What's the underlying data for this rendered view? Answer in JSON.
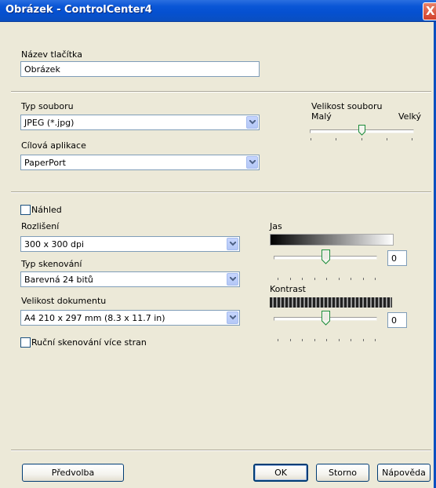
{
  "window": {
    "title": "Obrázek - ControlCenter4",
    "close_glyph": "X"
  },
  "button_name": {
    "label": "Název tlačítka",
    "value": "Obrázek"
  },
  "file_type": {
    "label": "Typ souboru",
    "value": "JPEG (*.jpg)"
  },
  "file_size": {
    "label": "Velikost souboru",
    "min_label": "Malý",
    "max_label": "Velký",
    "level": 0.5
  },
  "target_app": {
    "label": "Cílová aplikace",
    "value": "PaperPort"
  },
  "preview": {
    "label": "Náhled",
    "checked": false
  },
  "resolution": {
    "label": "Rozlišení",
    "value": "300 x 300 dpi"
  },
  "scan_type": {
    "label": "Typ skenování",
    "value": "Barevná 24 bitů"
  },
  "document_size": {
    "label": "Velikost dokumentu",
    "value": "A4 210 x 297 mm (8.3 x 11.7 in)"
  },
  "brightness": {
    "label": "Jas",
    "value": "0",
    "level": 0.5
  },
  "contrast": {
    "label": "Kontrast",
    "value": "0",
    "level": 0.5
  },
  "multipage": {
    "label": "Ruční skenování více stran",
    "checked": false
  },
  "buttons": {
    "preset": "Předvolba",
    "ok": "OK",
    "cancel": "Storno",
    "help": "Nápověda"
  }
}
